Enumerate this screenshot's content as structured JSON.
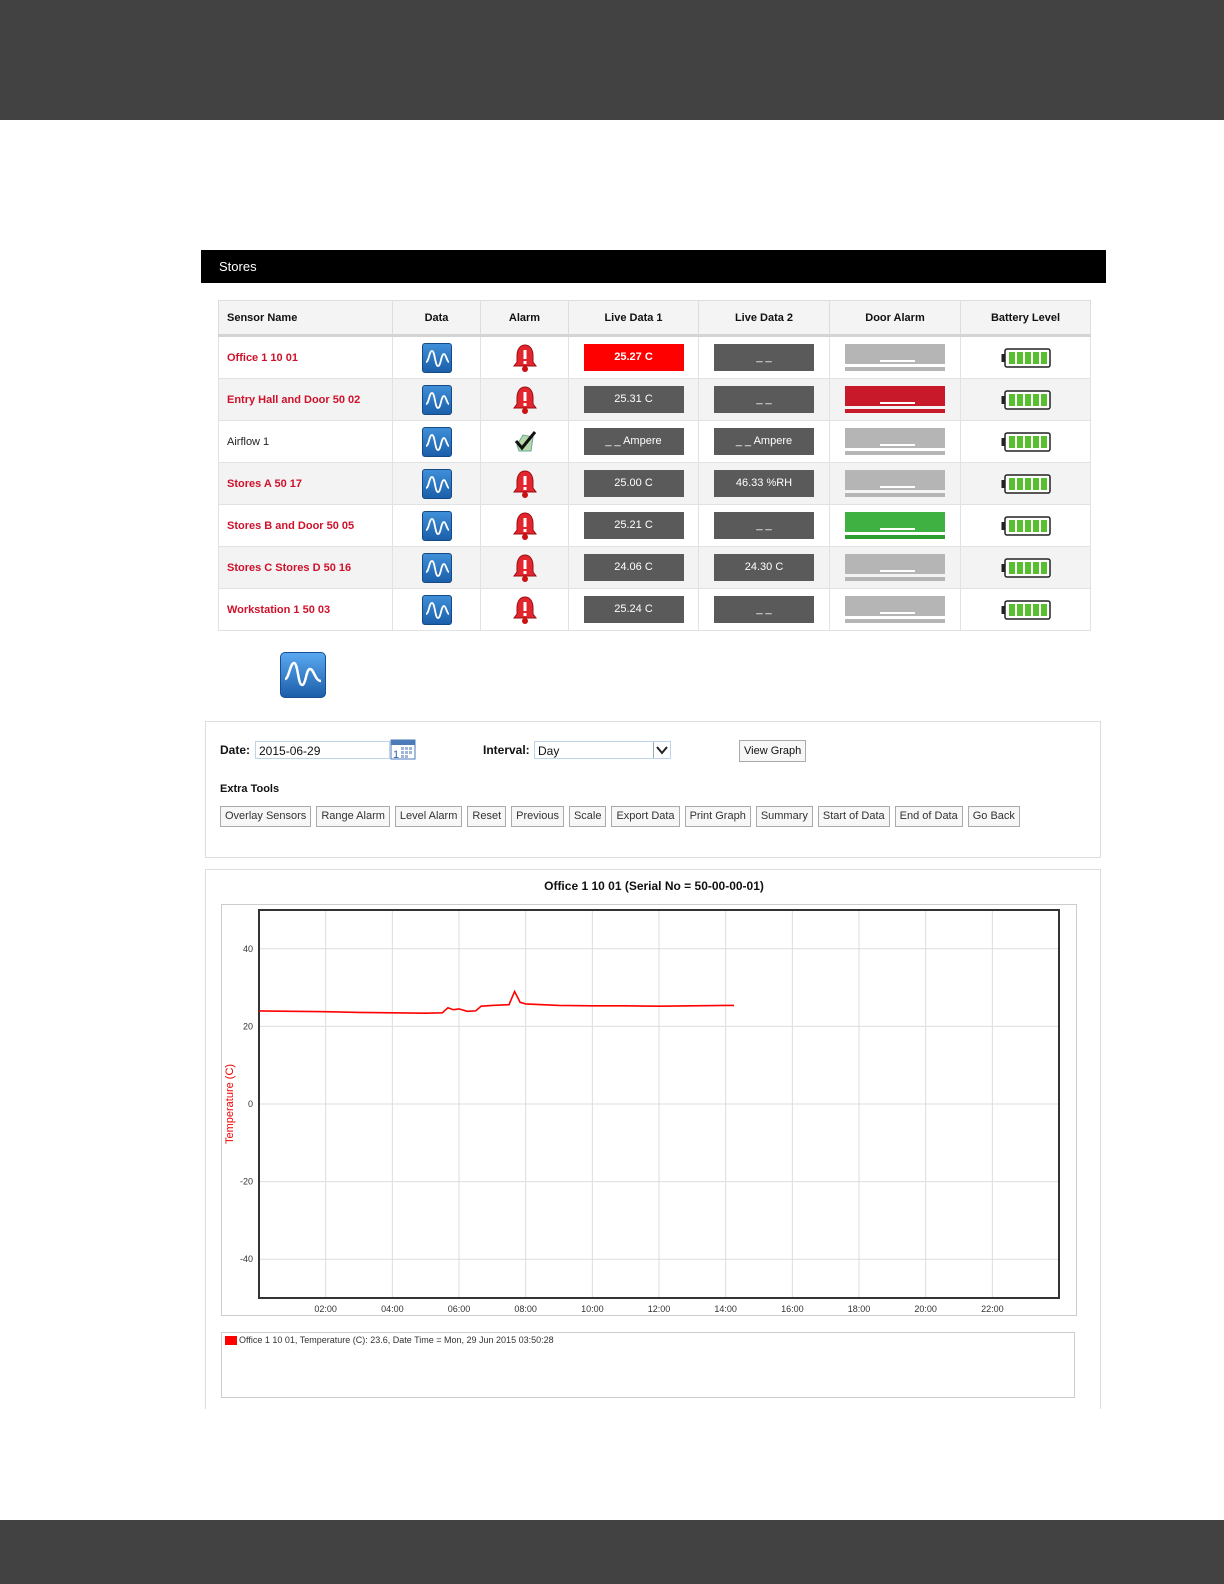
{
  "group": {
    "title": "Stores"
  },
  "table": {
    "headers": [
      "Sensor Name",
      "Data",
      "Alarm",
      "Live Data 1",
      "Live Data 2",
      "Door Alarm",
      "Battery Level"
    ],
    "rows": [
      {
        "name": "Office 1 10 01",
        "name_color": "red",
        "alarm": "bell",
        "live1": "25.27 C",
        "live1_style": "red",
        "live2": "_ _",
        "door": "grey"
      },
      {
        "name": "Entry Hall and Door 50 02",
        "name_color": "red",
        "alarm": "bell",
        "live1": "25.31 C",
        "live1_style": "grey",
        "live2": "_ _",
        "door": "red"
      },
      {
        "name": "Airflow 1",
        "name_color": "plain",
        "alarm": "check",
        "live1": "_ _ Ampere",
        "live1_style": "grey",
        "live2": "_ _ Ampere",
        "door": "grey"
      },
      {
        "name": "Stores A 50 17",
        "name_color": "red",
        "alarm": "bell",
        "live1": "25.00 C",
        "live1_style": "grey",
        "live2": "46.33 %RH",
        "door": "grey"
      },
      {
        "name": "Stores B and Door 50 05",
        "name_color": "red",
        "alarm": "bell",
        "live1": "25.21 C",
        "live1_style": "grey",
        "live2": "_ _",
        "door": "green"
      },
      {
        "name": "Stores C Stores D 50 16",
        "name_color": "red",
        "alarm": "bell",
        "live1": "24.06 C",
        "live1_style": "grey",
        "live2": "24.30 C",
        "door": "grey"
      },
      {
        "name": "Workstation 1 50 03",
        "name_color": "red",
        "alarm": "bell",
        "live1": "25.24 C",
        "live1_style": "grey",
        "live2": "_ _",
        "door": "grey"
      }
    ]
  },
  "controls": {
    "date_label": "Date:",
    "date_value": "2015-06-29",
    "interval_label": "Interval:",
    "interval_value": "Day",
    "view_graph": "View Graph",
    "extra_tools_label": "Extra Tools",
    "tools": [
      "Overlay Sensors",
      "Range Alarm",
      "Level Alarm",
      "Reset",
      "Previous",
      "Scale",
      "Export Data",
      "Print Graph",
      "Summary",
      "Start of Data",
      "End of Data",
      "Go Back"
    ]
  },
  "graph": {
    "title": "Office 1 10 01 (Serial No = 50-00-00-01)",
    "legend": "Office 1 10 01, Temperature (C): 23.6, Date Time = Mon, 29 Jun 2015 03:50:28"
  },
  "colors": {
    "alarm_red": "#d0112b",
    "series": "#ff0000",
    "header_bar": "#424242"
  },
  "chart_data": {
    "type": "line",
    "title": "Office 1 10 01 (Serial No = 50-00-00-01)",
    "ylabel": "Temperature (C)",
    "xlabel": "",
    "x_ticks": [
      "02:00",
      "04:00",
      "06:00",
      "08:00",
      "10:00",
      "12:00",
      "14:00",
      "16:00",
      "18:00",
      "20:00",
      "22:00"
    ],
    "y_ticks": [
      40,
      20,
      0,
      -20,
      -40
    ],
    "xlim": [
      "00:00",
      "24:00"
    ],
    "ylim": [
      -50,
      50
    ],
    "grid": true,
    "series": [
      {
        "name": "Office 1 10 01",
        "color": "#ff0000",
        "points": [
          [
            "00:00",
            24.0
          ],
          [
            "01:00",
            23.9
          ],
          [
            "02:00",
            23.8
          ],
          [
            "03:00",
            23.6
          ],
          [
            "04:00",
            23.5
          ],
          [
            "05:00",
            23.4
          ],
          [
            "05:30",
            23.5
          ],
          [
            "05:40",
            24.8
          ],
          [
            "05:50",
            24.3
          ],
          [
            "06:00",
            24.5
          ],
          [
            "06:15",
            23.9
          ],
          [
            "06:30",
            24.0
          ],
          [
            "06:40",
            25.2
          ],
          [
            "07:00",
            25.4
          ],
          [
            "07:15",
            25.5
          ],
          [
            "07:30",
            25.6
          ],
          [
            "07:40",
            29.0
          ],
          [
            "07:50",
            26.2
          ],
          [
            "08:00",
            25.8
          ],
          [
            "09:00",
            25.4
          ],
          [
            "10:00",
            25.3
          ],
          [
            "11:00",
            25.3
          ],
          [
            "12:00",
            25.2
          ],
          [
            "13:00",
            25.3
          ],
          [
            "14:00",
            25.4
          ],
          [
            "14:15",
            25.4
          ]
        ]
      }
    ]
  }
}
